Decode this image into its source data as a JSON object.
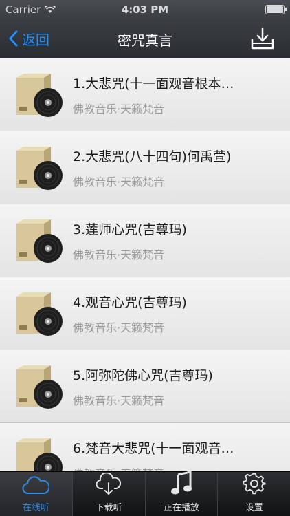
{
  "status_bar": {
    "carrier": "Carrier",
    "time": "4:03 PM",
    "battery_level": 1.0
  },
  "nav": {
    "back_label": "返回",
    "title": "密咒真言",
    "download_icon": "download-tray-icon"
  },
  "tracks": [
    {
      "title": "1.大悲咒(十一面观音根本…",
      "artist": "佛教音乐·天籁梵音"
    },
    {
      "title": "2.大悲咒(八十四句)何禹萱)",
      "artist": "佛教音乐·天籁梵音"
    },
    {
      "title": "3.莲师心咒(吉尊玛)",
      "artist": "佛教音乐·天籁梵音"
    },
    {
      "title": "4.观音心咒(吉尊玛)",
      "artist": "佛教音乐·天籁梵音"
    },
    {
      "title": "5.阿弥陀佛心咒(吉尊玛)",
      "artist": "佛教音乐·天籁梵音"
    },
    {
      "title": "6.梵音大悲咒(十一面观音…",
      "artist": "佛教音乐·天籁梵音"
    }
  ],
  "tabs": [
    {
      "label": "在线听",
      "icon": "cloud-icon",
      "active": true
    },
    {
      "label": "下载听",
      "icon": "cloud-download-icon",
      "active": false
    },
    {
      "label": "正在播放",
      "icon": "music-note-icon",
      "active": false
    },
    {
      "label": "设置",
      "icon": "gear-icon",
      "active": false
    }
  ],
  "colors": {
    "accent": "#2f8ce6",
    "back_blue": "#1e90ff",
    "bar_dark": "#2a2d31"
  }
}
